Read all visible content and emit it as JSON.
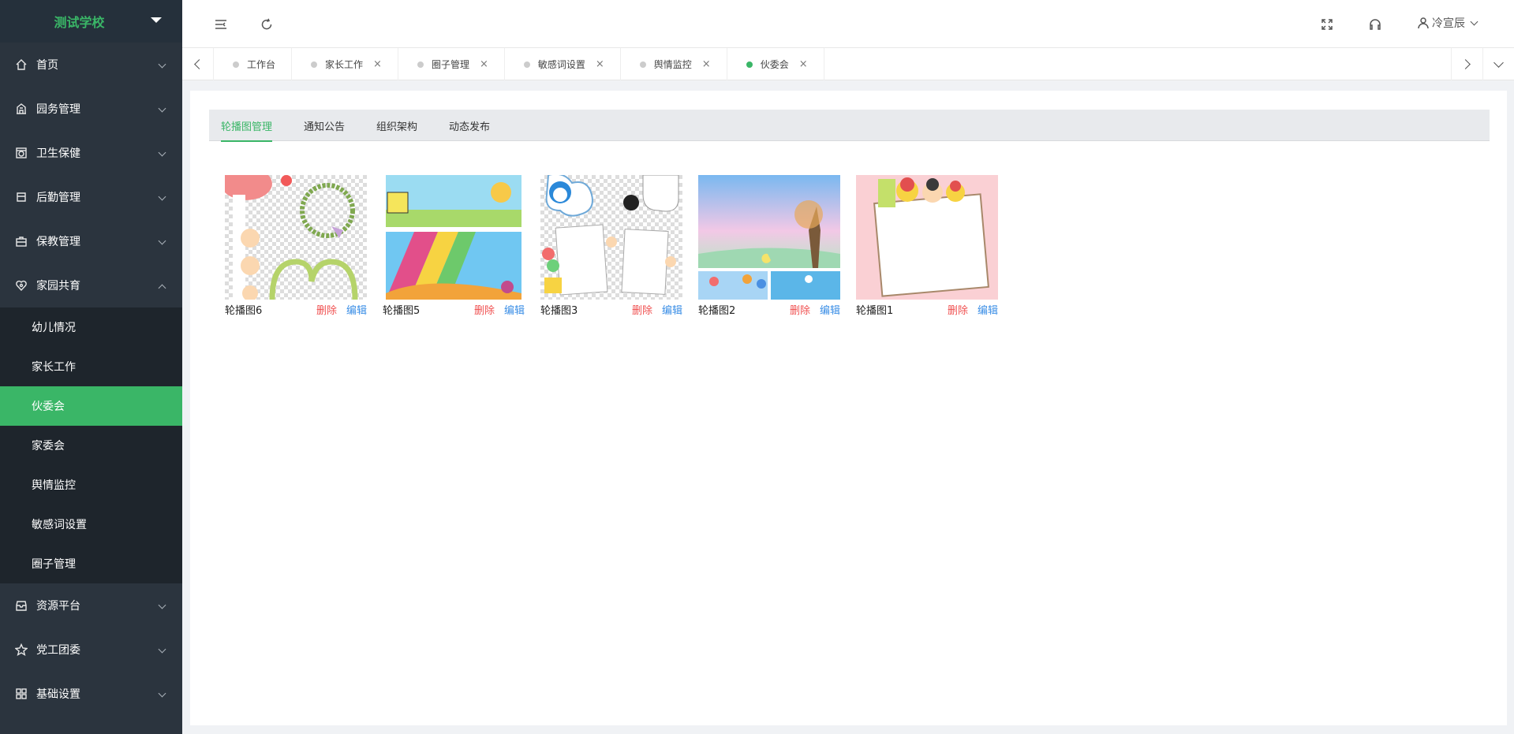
{
  "sidebar": {
    "brand": "测试学校",
    "menu": [
      {
        "label": "首页",
        "icon": "home-icon"
      },
      {
        "label": "园务管理",
        "icon": "building-icon"
      },
      {
        "label": "卫生保健",
        "icon": "health-icon"
      },
      {
        "label": "后勤管理",
        "icon": "logistics-icon"
      },
      {
        "label": "保教管理",
        "icon": "briefcase-icon"
      },
      {
        "label": "家园共育",
        "icon": "heart-icon"
      }
    ],
    "submenu": [
      "幼儿情况",
      "家长工作",
      "伙委会",
      "家委会",
      "舆情监控",
      "敏感词设置",
      "圈子管理"
    ],
    "menu_after": [
      {
        "label": "资源平台",
        "icon": "inbox-icon"
      },
      {
        "label": "党工团委",
        "icon": "star-icon"
      },
      {
        "label": "基础设置",
        "icon": "grid-icon"
      }
    ]
  },
  "header": {
    "username": "冷宣辰"
  },
  "tabs": [
    {
      "label": "工作台",
      "closable": false,
      "active": false
    },
    {
      "label": "家长工作",
      "closable": true,
      "active": false
    },
    {
      "label": "圈子管理",
      "closable": true,
      "active": false
    },
    {
      "label": "敏感词设置",
      "closable": true,
      "active": false
    },
    {
      "label": "舆情监控",
      "closable": true,
      "active": false
    },
    {
      "label": "伙委会",
      "closable": true,
      "active": true
    }
  ],
  "close_glyph": "×",
  "subtabs": [
    "轮播图管理",
    "通知公告",
    "组织架构",
    "动态发布"
  ],
  "cards": [
    {
      "name": "轮播图6",
      "delete": "删除",
      "edit": "编辑"
    },
    {
      "name": "轮播图5",
      "delete": "删除",
      "edit": "编辑"
    },
    {
      "name": "轮播图3",
      "delete": "删除",
      "edit": "编辑"
    },
    {
      "name": "轮播图2",
      "delete": "删除",
      "edit": "编辑"
    },
    {
      "name": "轮播图1",
      "delete": "删除",
      "edit": "编辑"
    }
  ],
  "colors": {
    "accent": "#3ab667",
    "sidebar_bg": "#2b343e",
    "submenu_bg": "#1e252c",
    "delete": "#f05050",
    "edit": "#3a8ee6"
  }
}
